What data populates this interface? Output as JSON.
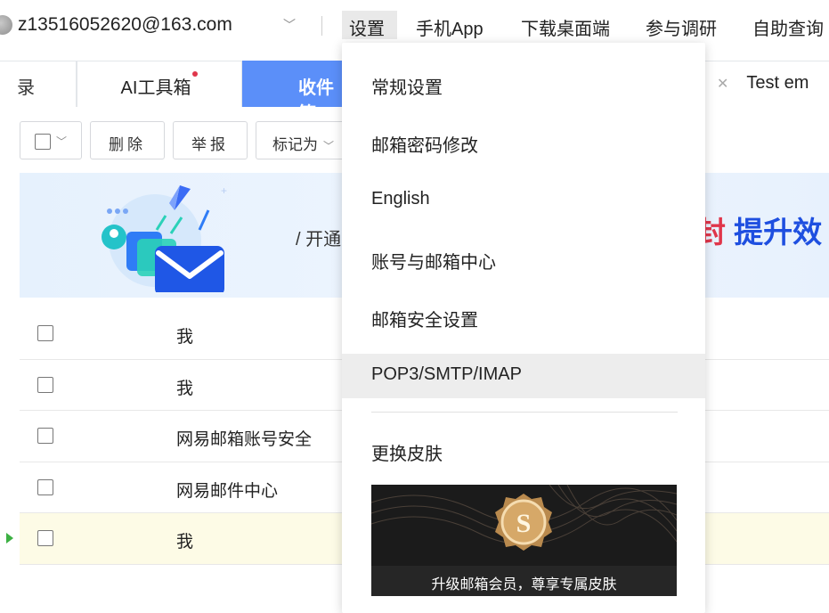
{
  "topbar": {
    "email": "z13516052620@163.com",
    "nav": [
      "设置",
      "手机App",
      "下载桌面端",
      "参与调研",
      "自助查询"
    ]
  },
  "tabs": {
    "prev_fragment": "录",
    "ai_tools": "AI工具箱",
    "inbox": "收件箱",
    "test_email": "Test em"
  },
  "toolbar": {
    "delete": "删除",
    "report": "举报",
    "mark_as": "标记为"
  },
  "banner": {
    "text": "/ 开通",
    "accent_red": "封",
    "accent_blue": "提升效"
  },
  "mail_list": [
    {
      "sender": "我",
      "highlight": false
    },
    {
      "sender": "我",
      "highlight": false
    },
    {
      "sender": "网易邮箱账号安全",
      "highlight": false
    },
    {
      "sender": "网易邮件中心",
      "highlight": false
    },
    {
      "sender": "我",
      "highlight": true
    }
  ],
  "settings_menu": {
    "items": [
      "常规设置",
      "邮箱密码修改",
      "English",
      "账号与邮箱中心",
      "邮箱安全设置",
      "POP3/SMTP/IMAP",
      "更换皮肤"
    ],
    "hovered": "POP3/SMTP/IMAP",
    "skin_promo": "升级邮箱会员，尊享专属皮肤"
  },
  "colors": {
    "inbox_tab": "#5b8ff9",
    "banner_blue": "#1e4fe0",
    "banner_red": "#e0364b",
    "row_arrow": "#3cb043"
  }
}
